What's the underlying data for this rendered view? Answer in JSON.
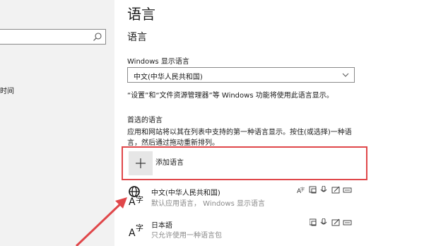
{
  "sidebar": {
    "search": {
      "value": "",
      "icon": "search-icon"
    },
    "partial_item": "时间"
  },
  "main": {
    "page_title": "语言",
    "section_title": "语言",
    "display_language": {
      "label": "Windows 显示语言",
      "selected": "中文(中华人民共和国)",
      "note": "“设置”和“文件资源管理器”等 Windows 功能将使用此语言显示。"
    },
    "preferred": {
      "heading": "首选的语言",
      "description": "应用和网站将以其在列表中支持的第一种语言显示。按住(或选择)一种语言，然后通过拖动重新排列。",
      "add_label": "添加语言",
      "languages": [
        {
          "name": "中文(中华人民共和国)",
          "sub": "默认应用语言，  Windows 显示语言",
          "features": [
            "display-language-icon",
            "speech-icon",
            "microphone-icon",
            "handwriting-icon",
            "keyboard-icon"
          ]
        },
        {
          "name": "日本語",
          "sub": "只允许使用一种语言包",
          "features": [
            "speech-icon",
            "microphone-icon",
            "handwriting-icon",
            "keyboard-icon"
          ]
        }
      ]
    }
  },
  "colors": {
    "highlight_border": "#e0474a",
    "arrow": "#e0474a"
  }
}
